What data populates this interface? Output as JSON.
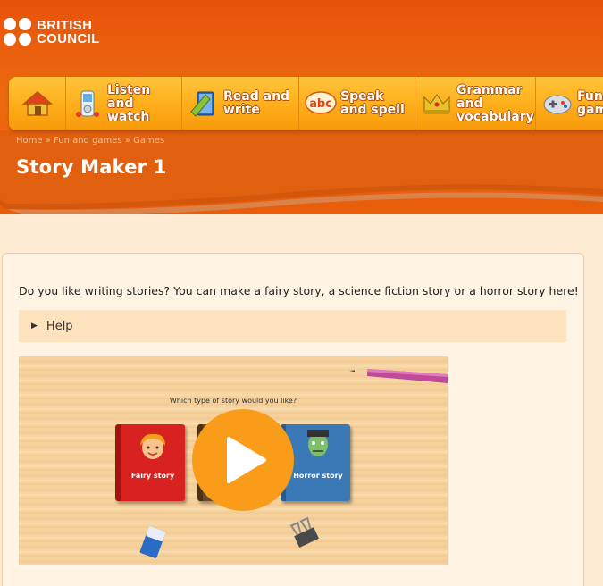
{
  "brand": {
    "line1": "BRITISH",
    "line2": "COUNCIL"
  },
  "nav": {
    "home_icon": "house-icon",
    "items": [
      {
        "label": "Listen and watch",
        "lines": [
          "Listen",
          "and",
          "watch"
        ],
        "icon": "mp3-player-icon"
      },
      {
        "label": "Read and write",
        "lines": [
          "Read and",
          "write"
        ],
        "icon": "book-pencil-icon"
      },
      {
        "label": "Speak and spell",
        "lines": [
          "Speak",
          "and spell"
        ],
        "icon": "abc-speech-icon"
      },
      {
        "label": "Grammar and vocabulary",
        "lines": [
          "Grammar",
          "and",
          "vocabulary"
        ],
        "icon": "crown-icon"
      },
      {
        "label": "Fun and games",
        "lines": [
          "Fun",
          "gam"
        ],
        "icon": "gamepad-icon"
      }
    ]
  },
  "breadcrumb": {
    "home": "Home",
    "sep": "»",
    "fun": "Fun and games",
    "games": "Games"
  },
  "page": {
    "title": "Story Maker 1",
    "intro": "Do you like writing stories? You can make a fairy story, a science fiction story or a horror story here!",
    "help_label": "Help"
  },
  "game": {
    "question": "Which type of story would you like?",
    "books": [
      "Fairy story",
      "",
      "Horror story"
    ],
    "play_icon": "play-icon"
  },
  "colors": {
    "header": "#e8530a",
    "nav": "#ffb020",
    "accent": "#f89c1a",
    "background": "#fdebd3"
  }
}
